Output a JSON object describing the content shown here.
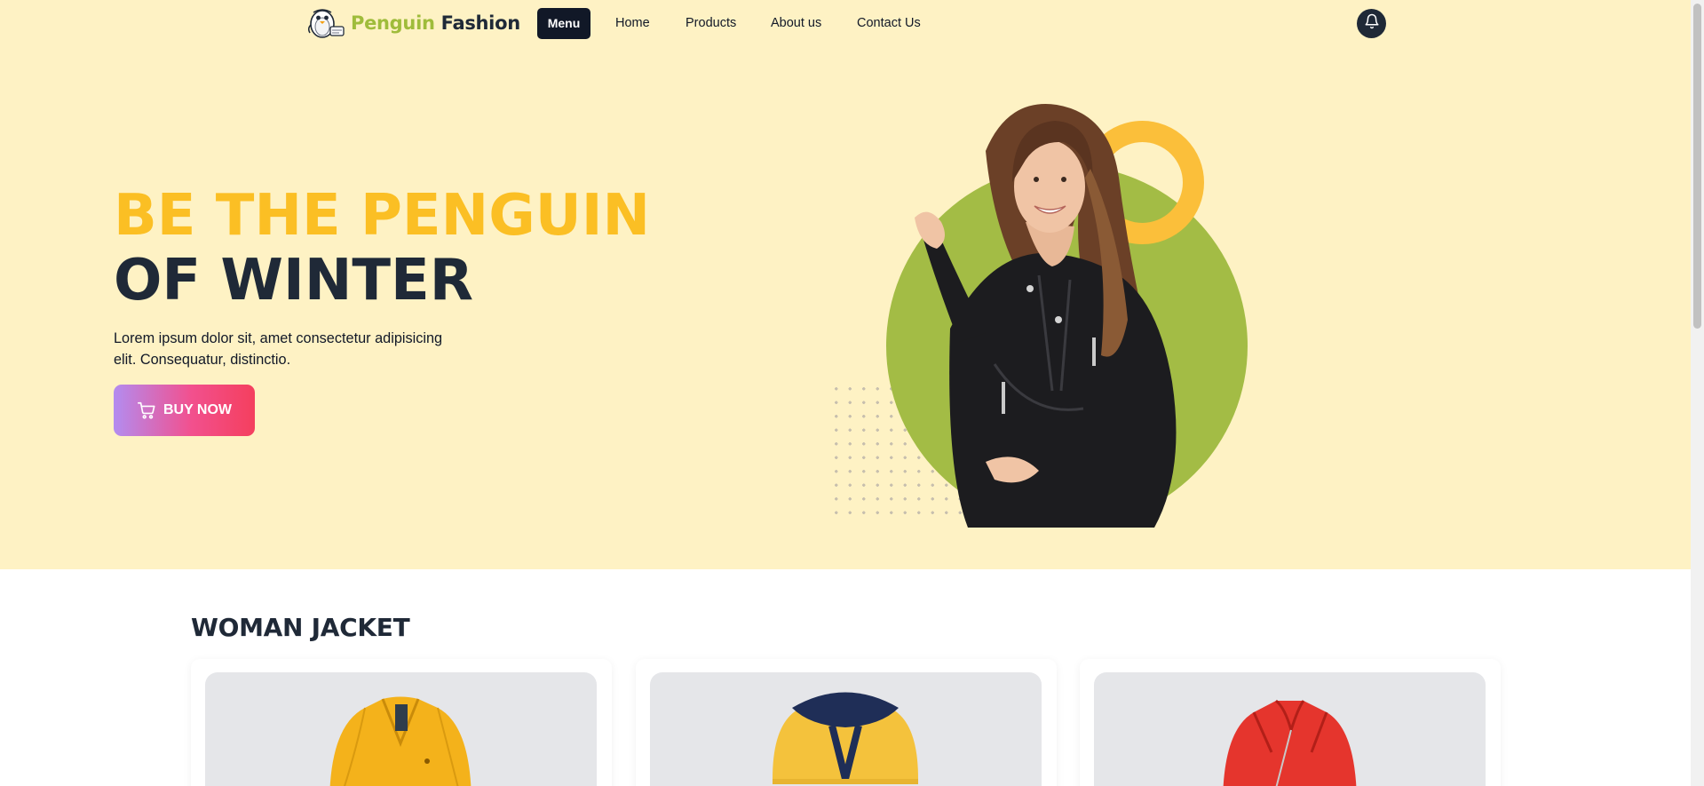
{
  "nav": {
    "logo_word1": "Penguin",
    "logo_word2": "Fashion",
    "menu_label": "Menu",
    "items": [
      {
        "label": "Home"
      },
      {
        "label": "Products"
      },
      {
        "label": "About us"
      },
      {
        "label": "Contact Us"
      }
    ],
    "notification_icon": "bell-icon"
  },
  "hero": {
    "headline_line1": "BE THE PENGUIN",
    "headline_line2": "OF WINTER",
    "description": "Lorem ipsum dolor sit, amet consectetur adipisicing elit. Consequatur, distinctio.",
    "cta_label": "BUY NOW",
    "cta_icon": "cart-icon"
  },
  "products": {
    "section_title": "WOMAN JACKET",
    "cards": [
      {
        "image": "yellow-jacket-image"
      },
      {
        "image": "yellow-hooded-jacket-image"
      },
      {
        "image": "red-leather-jacket-image"
      }
    ]
  },
  "colors": {
    "hero_background": "#fef2c4",
    "headline_accent": "#fbbf24",
    "headline_dark": "#1f2937",
    "logo_green": "#9fbc3b",
    "circle_green": "#a3bc45",
    "ring_yellow": "#fbbf3a",
    "cta_gradient_start": "#b38cf0",
    "cta_gradient_end": "#f43f5e"
  }
}
